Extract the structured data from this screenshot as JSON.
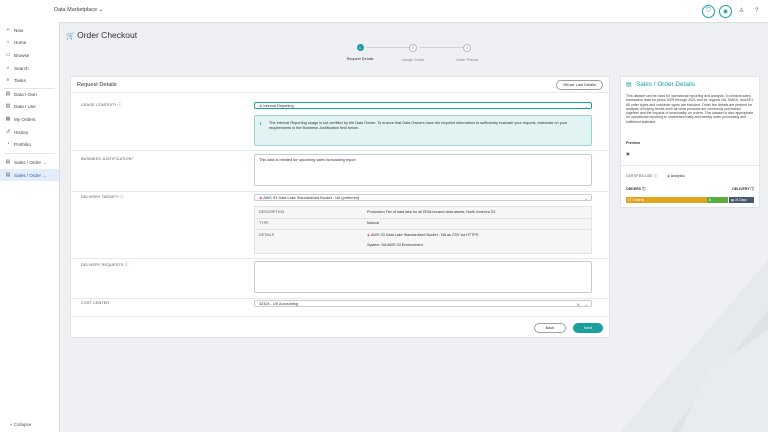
{
  "app": {
    "title": "Data Marketplace",
    "title_chevron": "⌄"
  },
  "topbar": {
    "icons": [
      "cart-icon",
      "notification-icon",
      "user-icon",
      "help-icon"
    ]
  },
  "sidebar": {
    "items": [
      {
        "label": "New",
        "icon": "+"
      },
      {
        "label": "Home",
        "icon": "⌂"
      },
      {
        "label": "Browse",
        "icon": "▭"
      },
      {
        "label": "Search",
        "icon": "⌕"
      },
      {
        "label": "Tasks",
        "icon": "≡"
      },
      {
        "label": "Data I Own",
        "icon": "▤"
      },
      {
        "label": "Data I Use",
        "icon": "▧"
      },
      {
        "label": "My Orders",
        "icon": "▦"
      },
      {
        "label": "History",
        "icon": "↺"
      },
      {
        "label": "Portfolio",
        "icon": "◔"
      },
      {
        "label": "Sales / Order ...",
        "icon": "▤"
      },
      {
        "label": "Sales / Order ...",
        "icon": "▤"
      }
    ],
    "collapse_label": "Collapse"
  },
  "page": {
    "title": "Order Checkout",
    "title_icon": "🛒"
  },
  "steps": [
    {
      "num": "1",
      "label": "Request Details",
      "active": true
    },
    {
      "num": "2",
      "label": "Usage Guide",
      "active": false
    },
    {
      "num": "3",
      "label": "Order Placed",
      "active": false
    }
  ],
  "form": {
    "title": "Request Details",
    "reuse_button": "Reuse Last Details",
    "usage_context": {
      "label": "USAGE CONTEXT*",
      "value": "Internal Reporting"
    },
    "info_message": "The Internal Reporting usage is not certified by the Data Owner. To ensure that Data Owners have the required information to sufficiently evaluate your request, elaborate on your requirements in the Business Justification field below.",
    "business_justification": {
      "label": "BUSINESS JUSTIFICATION*",
      "value": "This data is needed for upcoming sales forecasting report"
    },
    "delivery_target": {
      "label": "DELIVERY TARGET*",
      "value": "AWS S3 Data Lake Standardized Bucket - NA (preferred)"
    },
    "details_table": [
      {
        "key": "DESCRIPTION",
        "value": "Production Tier of data lake for all EDM-housed data assets, North America S3"
      },
      {
        "key": "TYPE",
        "value": "Manual"
      },
      {
        "key": "DETAILS",
        "value": "AWS S3 Data Lake Standardized Bucket - NA as CSV via HTTPS",
        "value2": "System: NA AWS S3 Environment"
      }
    ],
    "delivery_requests": {
      "label": "DELIVERY REQUESTS",
      "value": ""
    },
    "cost_center": {
      "label": "COST CENTER",
      "value": "32324 - US Accounting"
    },
    "back_button": "Back",
    "next_button": "Next"
  },
  "details_panel": {
    "title": "Sales / Order Details",
    "description": "This dataset can be used for operational reporting and analysis. It contains sales transaction data for years 2009 through 2021 and for regions NA, EMEA, and APJ. All order types and customer types are included. Order line details are present for analysis of buying trends such as what products are commonly purchased together and the impacts of seasonality on orders. This dataset is also appropriate for operational reporting to understand daily and weekly order processing and fulfillment statistics.",
    "preview_label": "Preview",
    "certified_use_label": "CERTIFIED USE",
    "certified_use_value": "Analytics",
    "orders_label": "ORDERS",
    "delivery_label": "DELIVERY",
    "orders_bar_label": "17 Ordered",
    "orders_bar_count": "8",
    "delivery_bar_label": "24 Days",
    "colors": {
      "ordered": "#e0a41f",
      "pending": "#5cae3b",
      "delivery": "#4a5a6d"
    }
  },
  "colors": {
    "accent": "#1a9e9e"
  }
}
